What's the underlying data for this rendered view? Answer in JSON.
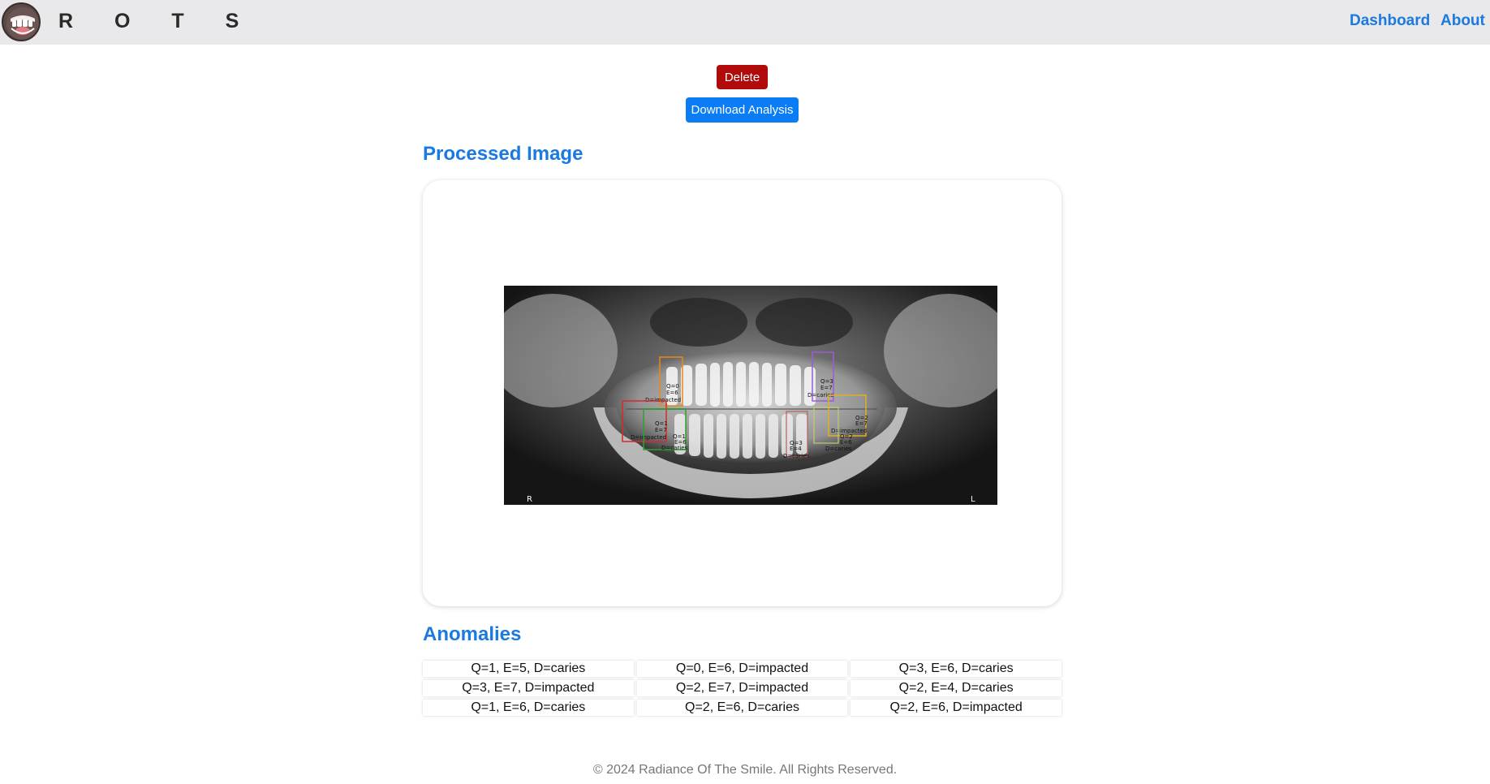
{
  "navbar": {
    "brand": "R O T S",
    "logo_icon": "smiling-tooth-mouth-logo",
    "links": [
      {
        "label": "Dashboard"
      },
      {
        "label": "About"
      }
    ]
  },
  "actions": {
    "delete_label": "Delete",
    "download_label": "Download Analysis"
  },
  "processed": {
    "title": "Processed Image",
    "xray_corner_left": "R",
    "xray_corner_right": "L",
    "annotations": [
      {
        "q": "Q=0",
        "e": "E=6",
        "d": "D=impacted",
        "color": "#e58a1a"
      },
      {
        "q": "Q=1",
        "e": "E=7",
        "d": "D=impacted",
        "color": "#d62a2a"
      },
      {
        "q": "Q=1",
        "e": "E=6",
        "d": "D=caries",
        "color": "#2fa02f"
      },
      {
        "q": "Q=3",
        "e": "E=4",
        "d": "D=caries",
        "color": "#b56060"
      },
      {
        "q": "Q=3",
        "e": "E=7",
        "d": "D=caries",
        "color": "#9a5bd6"
      },
      {
        "q": "Q=2",
        "e": "E=7",
        "d": "D=impacted",
        "color": "#e0b020"
      },
      {
        "q": "Q=2",
        "e": "E=6",
        "d": "D=caries",
        "color": "#c8c870"
      }
    ]
  },
  "anomalies": {
    "title": "Anomalies",
    "items": [
      "Q=1, E=5, D=caries",
      "Q=0, E=6, D=impacted",
      "Q=3, E=6, D=caries",
      "Q=3, E=7, D=impacted",
      "Q=2, E=7, D=impacted",
      "Q=2, E=4, D=caries",
      "Q=1, E=6, D=caries",
      "Q=2, E=6, D=caries",
      "Q=2, E=6, D=impacted"
    ]
  },
  "colors": {
    "accent": "#1a7ae0",
    "delete": "#b00a0a",
    "download": "#0a7cf5",
    "navbar_bg": "#e9e8ea"
  },
  "footer": {
    "text": "© 2024 Radiance Of The Smile. All Rights Reserved."
  }
}
